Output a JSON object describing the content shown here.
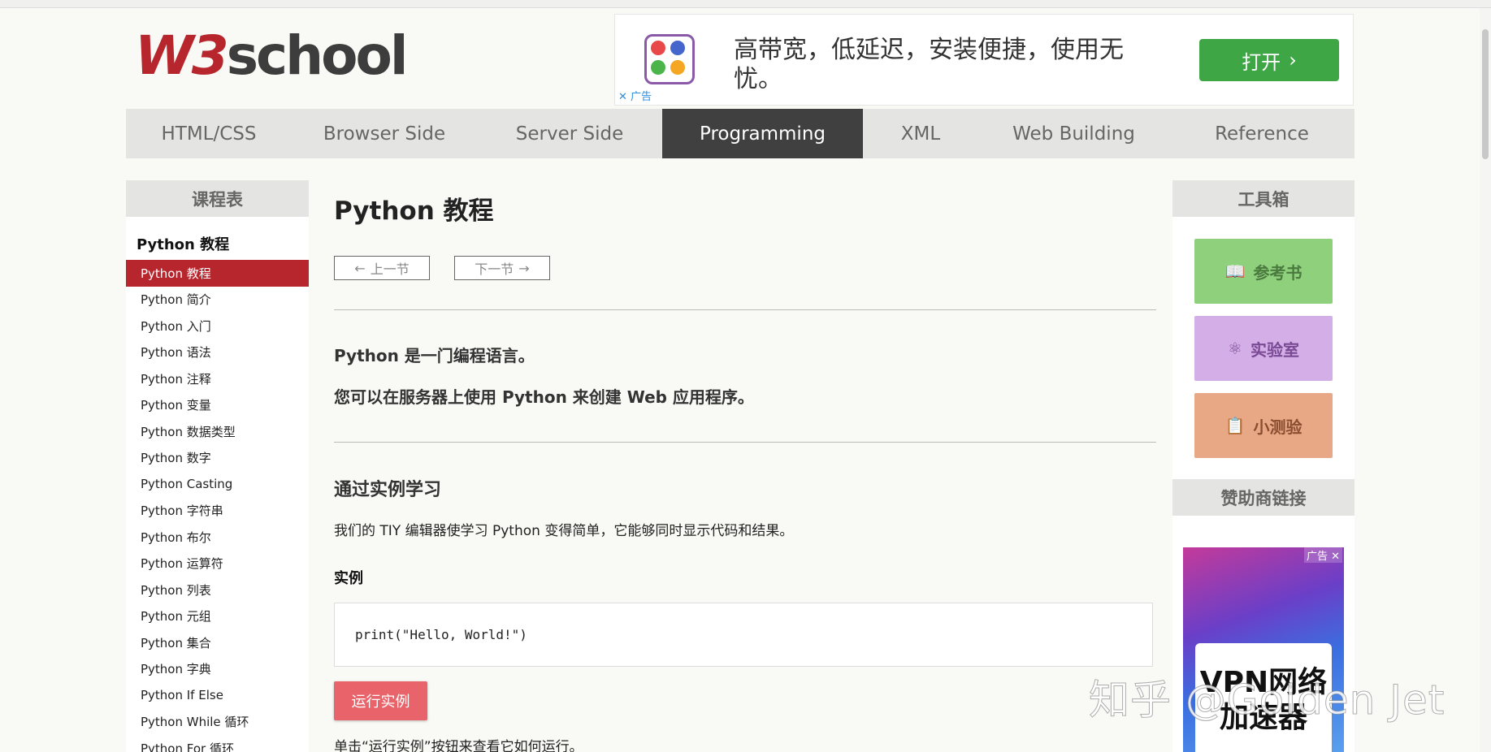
{
  "logo": {
    "part1": "W3",
    "part2": "school"
  },
  "top_ad": {
    "text": "高带宽，低延迟，安装便捷，使用无忧。",
    "button": "打开",
    "tag": "广告"
  },
  "nav": {
    "items": [
      "HTML/CSS",
      "Browser Side",
      "Server Side",
      "Programming",
      "XML",
      "Web Building",
      "Reference"
    ],
    "active": "Programming"
  },
  "sidebar": {
    "header": "课程表",
    "title": "Python 教程",
    "items": [
      "Python 教程",
      "Python 简介",
      "Python 入门",
      "Python 语法",
      "Python 注释",
      "Python 变量",
      "Python 数据类型",
      "Python 数字",
      "Python Casting",
      "Python 字符串",
      "Python 布尔",
      "Python 运算符",
      "Python 列表",
      "Python 元组",
      "Python 集合",
      "Python 字典",
      "Python If Else",
      "Python While 循环",
      "Python For 循环"
    ],
    "active": "Python 教程"
  },
  "main": {
    "title": "Python 教程",
    "prev": "上一节",
    "next": "下一节",
    "lead1": "Python 是一门编程语言。",
    "lead2": "您可以在服务器上使用 Python 来创建 Web 应用程序。",
    "section_title": "通过实例学习",
    "section_text": "我们的 TIY 编辑器使学习 Python 变得简单，它能够同时显示代码和结果。",
    "example_label": "实例",
    "code": "print(\"Hello, World!\")",
    "run_button": "运行实例",
    "hint": "单击“运行实例”按钮来查看它如何运行。"
  },
  "toolbox": {
    "header": "工具箱",
    "buttons": [
      {
        "label": "参考书",
        "icon": "book-icon",
        "bg": "#8fd07d",
        "fg": "#4a7a3e"
      },
      {
        "label": "实验室",
        "icon": "atom-icon",
        "bg": "#d4aee6",
        "fg": "#7a4a94"
      },
      {
        "label": "小测验",
        "icon": "clipboard-icon",
        "bg": "#e8a886",
        "fg": "#8a4e30"
      }
    ],
    "sponsor_header": "赞助商链接",
    "sponsor_ad_tag": "广告",
    "sponsor_ad_text1": "VPN网络",
    "sponsor_ad_text2": "加速器"
  },
  "watermark": "知乎 @Golden Jet",
  "colors": {
    "brand": "#b7252d",
    "nav_active": "#404040",
    "run_button": "#e8646a",
    "ad_button": "#3fa646"
  }
}
